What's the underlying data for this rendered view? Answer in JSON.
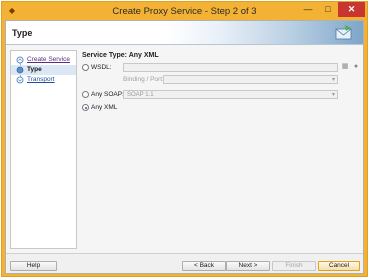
{
  "window": {
    "title": "Create Proxy Service - Step 2 of 3",
    "minimize_glyph": "—",
    "maximize_glyph": "□",
    "close_glyph": "✕"
  },
  "header": {
    "title": "Type"
  },
  "nav": {
    "items": [
      {
        "label": "Create Service",
        "state": "done"
      },
      {
        "label": "Type",
        "state": "current"
      },
      {
        "label": "Transport",
        "state": "todo"
      }
    ]
  },
  "content": {
    "section_title": "Service Type: Any XML",
    "wsdl": {
      "label": "WSDL:",
      "value": "",
      "selected": false
    },
    "binding_port": {
      "label": "Binding / Port:",
      "value": ""
    },
    "any_soap": {
      "label": "Any SOAP:",
      "value": "SOAP 1.1",
      "selected": false
    },
    "any_xml": {
      "label": "Any XML",
      "selected": true
    }
  },
  "footer": {
    "help": "Help",
    "back": "< Back",
    "next": "Next >",
    "finish": "Finish",
    "cancel": "Cancel"
  },
  "colors": {
    "title_bar": "#f3b234",
    "close_button": "#c7372f",
    "link_visited": "#5a2d82",
    "link": "#1f4e9c"
  }
}
